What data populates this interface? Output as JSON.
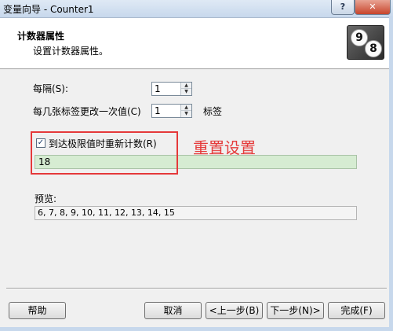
{
  "window": {
    "title": "变量向导 - Counter1",
    "help_label": "?",
    "close_label": "✕"
  },
  "header": {
    "title": "计数器属性",
    "subtitle": "设置计数器属性。",
    "logo_digits": [
      "9",
      "8"
    ]
  },
  "form": {
    "interval_label": "每隔(S):",
    "interval_value": "1",
    "labels_per_change_label": "每几张标签更改一次值(C)",
    "labels_per_change_value": "1",
    "labels_unit": "标签",
    "reset_checkbox_label": "到达极限值时重新计数(R)",
    "reset_checked": true,
    "reset_value": "18",
    "preview_label": "预览:",
    "preview_value": "6, 7, 8, 9, 10, 11, 12, 13, 14, 15"
  },
  "annotation": {
    "text": "重置设置",
    "color": "#e53b3b"
  },
  "buttons": {
    "help": "帮助",
    "cancel": "取消",
    "back": "<上一步(B)",
    "next": "下一步(N)>",
    "finish": "完成(F)"
  }
}
